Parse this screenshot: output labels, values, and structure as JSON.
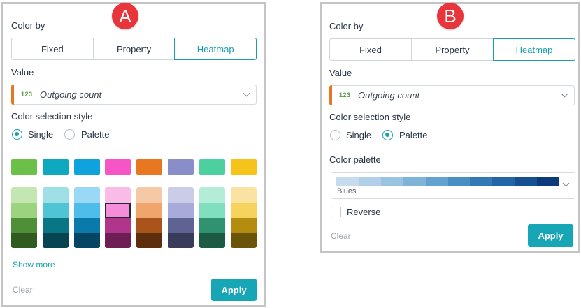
{
  "panel_a": {
    "badge": "A",
    "color_by_label": "Color by",
    "modes": [
      "Fixed",
      "Property",
      "Heatmap"
    ],
    "active_mode": "Heatmap",
    "value_label": "Value",
    "value_field": {
      "type": "123",
      "name": "Outgoing count"
    },
    "style_label": "Color selection style",
    "style_options": {
      "single": "Single",
      "palette": "Palette"
    },
    "selected_style": "Single",
    "base_colors": [
      "#6cc04a",
      "#0fa9bf",
      "#0fa3dd",
      "#f655c5",
      "#e87722",
      "#8a8ec8",
      "#4dd0a0",
      "#f5c319"
    ],
    "shade_columns": [
      [
        "#c4e6b3",
        "#9bd37f",
        "#4f8f37",
        "#2f5a20"
      ],
      [
        "#9fdfe6",
        "#4fc4d2",
        "#087684",
        "#054450"
      ],
      [
        "#9ad9f5",
        "#4fbde9",
        "#097aaa",
        "#054463"
      ],
      [
        "#fbbbe9",
        "#f58ddb",
        "#b0368c",
        "#6e1e55"
      ],
      [
        "#f5c8a6",
        "#efa56b",
        "#a9541a",
        "#5d2e0e"
      ],
      [
        "#cbcde8",
        "#a8abda",
        "#5f6392",
        "#383b5a"
      ],
      [
        "#b3ecd7",
        "#7fdfbe",
        "#2f9270",
        "#1c5a44"
      ],
      [
        "#fae3a0",
        "#f6d35c",
        "#b48c10",
        "#6a5409"
      ]
    ],
    "selected_shade": "#f58ddb",
    "show_more": "Show more",
    "clear": "Clear",
    "apply": "Apply"
  },
  "panel_b": {
    "badge": "B",
    "color_by_label": "Color by",
    "modes": [
      "Fixed",
      "Property",
      "Heatmap"
    ],
    "active_mode": "Heatmap",
    "value_label": "Value",
    "value_field": {
      "type": "123",
      "name": "Outgoing count"
    },
    "style_label": "Color selection style",
    "style_options": {
      "single": "Single",
      "palette": "Palette"
    },
    "selected_style": "Palette",
    "palette_label": "Color palette",
    "palette_name": "Blues",
    "palette_colors": [
      "#c6dbef",
      "#b1cfe8",
      "#9ac3e0",
      "#7fb3d8",
      "#63a1cf",
      "#4a8fc4",
      "#3379b6",
      "#2365a6",
      "#164f92",
      "#0b3b7a"
    ],
    "reverse_label": "Reverse",
    "reverse_checked": false,
    "clear": "Clear",
    "apply": "Apply"
  }
}
